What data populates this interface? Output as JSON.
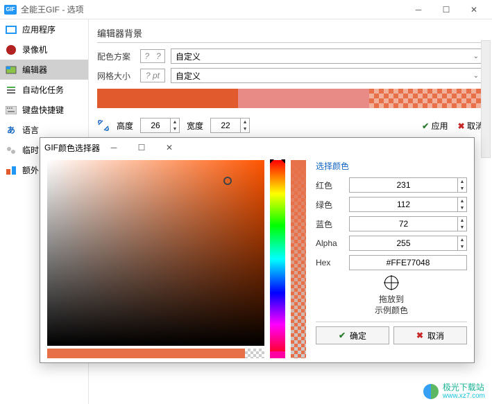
{
  "window": {
    "app_icon_text": "GIF",
    "title": "全能王GIF - 选项"
  },
  "sidebar": {
    "items": [
      {
        "label": "应用程序",
        "color": "#fff",
        "border": "#2196F3"
      },
      {
        "label": "录像机",
        "color": "#B22222",
        "round": true
      },
      {
        "label": "编辑器",
        "icon": "editor"
      },
      {
        "label": "自动化任务",
        "icon": "tasks"
      },
      {
        "label": "键盘快捷键",
        "icon": "keyboard"
      },
      {
        "label": "语言",
        "icon": "lang"
      },
      {
        "label": "临时",
        "icon": "temp"
      },
      {
        "label": "额外",
        "icon": "extras"
      }
    ],
    "selected_index": 2
  },
  "editor": {
    "section_title": "编辑器背景",
    "scheme_label": "配色方案",
    "scheme_placeholder": "?   ?",
    "scheme_value": "自定义",
    "grid_label": "网格大小",
    "grid_placeholder": "? pt",
    "grid_value": "自定义",
    "dim_icon": "resize-icon",
    "height_label": "高度",
    "height_value": "26",
    "width_label": "宽度",
    "width_value": "22",
    "apply_label": "应用",
    "cancel_label": "取消"
  },
  "picker": {
    "title": "颜色选择器",
    "select_label": "选择颜色",
    "red_label": "红色",
    "red_value": "231",
    "green_label": "绿色",
    "green_value": "112",
    "blue_label": "蓝色",
    "blue_value": "72",
    "alpha_label": "Alpha",
    "alpha_value": "255",
    "hex_label": "Hex",
    "hex_value": "#FFE77048",
    "eyedrop_line1": "拖放到",
    "eyedrop_line2": "示例颜色",
    "ok_label": "确定",
    "cancel_label": "取消",
    "current_color": "#E77048"
  },
  "watermark": {
    "name": "极光下载站",
    "url": "www.xz7.com"
  }
}
